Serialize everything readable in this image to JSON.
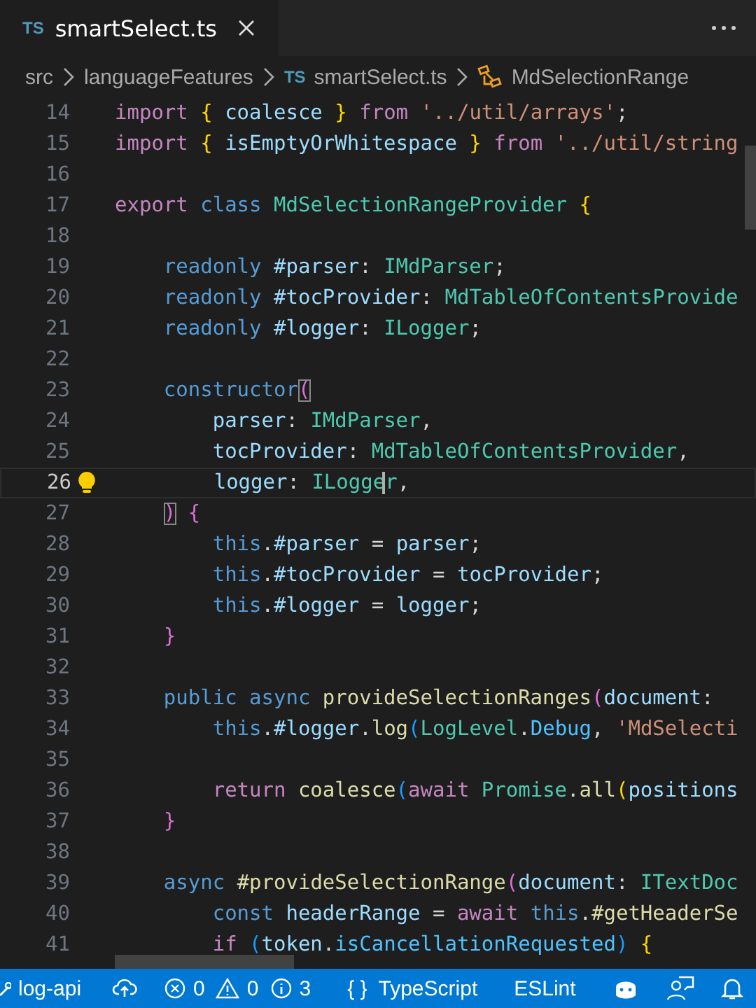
{
  "tabs": [
    {
      "lang": "TS",
      "label": "smartSelect.ts",
      "selected": true
    }
  ],
  "breadcrumbs": [
    {
      "kind": "folder",
      "label": "src"
    },
    {
      "kind": "folder",
      "label": "languageFeatures"
    },
    {
      "kind": "file",
      "lang": "TS",
      "label": "smartSelect.ts"
    },
    {
      "kind": "class",
      "label": "MdSelectionRange"
    }
  ],
  "code_lines": [
    {
      "number": "14",
      "tokens": [
        {
          "kind": "keyword",
          "text": "import "
        },
        {
          "kind": "bracket1",
          "text": "{"
        },
        {
          "kind": "variable",
          "text": " coalesce "
        },
        {
          "kind": "bracket1",
          "text": "}"
        },
        {
          "kind": "keyword",
          "text": " from "
        },
        {
          "kind": "string",
          "text": "'../util/arrays'"
        },
        {
          "kind": "plain",
          "text": ";"
        }
      ]
    },
    {
      "number": "15",
      "tokens": [
        {
          "kind": "keyword",
          "text": "import "
        },
        {
          "kind": "bracket1",
          "text": "{"
        },
        {
          "kind": "variable",
          "text": " isEmptyOrWhitespace "
        },
        {
          "kind": "bracket1",
          "text": "}"
        },
        {
          "kind": "keyword",
          "text": " from "
        },
        {
          "kind": "string",
          "text": "'../util/string"
        }
      ]
    },
    {
      "number": "16"
    },
    {
      "number": "17",
      "tokens": [
        {
          "kind": "keyword",
          "text": "export "
        },
        {
          "kind": "storage",
          "text": "class "
        },
        {
          "kind": "type",
          "text": "MdSelectionRangeProvider "
        },
        {
          "kind": "bracket1",
          "text": "{"
        }
      ]
    },
    {
      "number": "18"
    },
    {
      "number": "19",
      "tokens": [
        {
          "kind": "storage",
          "text": "    readonly "
        },
        {
          "kind": "variable",
          "text": "#parser"
        },
        {
          "kind": "plain",
          "text": ": "
        },
        {
          "kind": "type",
          "text": "IMdParser"
        },
        {
          "kind": "plain",
          "text": ";"
        }
      ]
    },
    {
      "number": "20",
      "tokens": [
        {
          "kind": "storage",
          "text": "    readonly "
        },
        {
          "kind": "variable",
          "text": "#tocProvider"
        },
        {
          "kind": "plain",
          "text": ": "
        },
        {
          "kind": "type",
          "text": "MdTableOfContentsProvide"
        }
      ]
    },
    {
      "number": "21",
      "tokens": [
        {
          "kind": "storage",
          "text": "    readonly "
        },
        {
          "kind": "variable",
          "text": "#logger"
        },
        {
          "kind": "plain",
          "text": ": "
        },
        {
          "kind": "type",
          "text": "ILogger"
        },
        {
          "kind": "plain",
          "text": ";"
        }
      ]
    },
    {
      "number": "22"
    },
    {
      "number": "23",
      "tokens": [
        {
          "kind": "storage",
          "text": "    constructor"
        },
        {
          "kind": "bracket2",
          "text": "(",
          "matched": true
        }
      ]
    },
    {
      "number": "24",
      "tokens": [
        {
          "kind": "variable",
          "text": "        parser"
        },
        {
          "kind": "plain",
          "text": ": "
        },
        {
          "kind": "type",
          "text": "IMdParser"
        },
        {
          "kind": "plain",
          "text": ","
        }
      ]
    },
    {
      "number": "25",
      "tokens": [
        {
          "kind": "variable",
          "text": "        tocProvider"
        },
        {
          "kind": "plain",
          "text": ": "
        },
        {
          "kind": "type",
          "text": "MdTableOfContentsProvider"
        },
        {
          "kind": "plain",
          "text": ","
        }
      ]
    },
    {
      "number": "26",
      "current": true,
      "lightbulb": true,
      "tokens": [
        {
          "kind": "variable",
          "text": "        logger"
        },
        {
          "kind": "plain",
          "text": ": "
        },
        {
          "kind": "type",
          "text": "ILogge"
        },
        {
          "kind": "type",
          "text": "r",
          "cursor": true
        },
        {
          "kind": "plain",
          "text": ","
        }
      ]
    },
    {
      "number": "27",
      "tokens": [
        {
          "kind": "bracket2",
          "text": "    )",
          "matched": true
        },
        {
          "kind": "bracket2",
          "text": " {"
        }
      ]
    },
    {
      "number": "28",
      "tokens": [
        {
          "kind": "storage",
          "text": "        this"
        },
        {
          "kind": "plain",
          "text": "."
        },
        {
          "kind": "variable",
          "text": "#parser"
        },
        {
          "kind": "plain",
          "text": " = "
        },
        {
          "kind": "variable",
          "text": "parser"
        },
        {
          "kind": "plain",
          "text": ";"
        }
      ]
    },
    {
      "number": "29",
      "tokens": [
        {
          "kind": "storage",
          "text": "        this"
        },
        {
          "kind": "plain",
          "text": "."
        },
        {
          "kind": "variable",
          "text": "#tocProvider"
        },
        {
          "kind": "plain",
          "text": " = "
        },
        {
          "kind": "variable",
          "text": "tocProvider"
        },
        {
          "kind": "plain",
          "text": ";"
        }
      ]
    },
    {
      "number": "30",
      "tokens": [
        {
          "kind": "storage",
          "text": "        this"
        },
        {
          "kind": "plain",
          "text": "."
        },
        {
          "kind": "variable",
          "text": "#logger"
        },
        {
          "kind": "plain",
          "text": " = "
        },
        {
          "kind": "variable",
          "text": "logger"
        },
        {
          "kind": "plain",
          "text": ";"
        }
      ]
    },
    {
      "number": "31",
      "tokens": [
        {
          "kind": "bracket2",
          "text": "    }"
        }
      ]
    },
    {
      "number": "32"
    },
    {
      "number": "33",
      "tokens": [
        {
          "kind": "storage",
          "text": "    public async "
        },
        {
          "kind": "function",
          "text": "provideSelectionRanges"
        },
        {
          "kind": "bracket2",
          "text": "("
        },
        {
          "kind": "variable",
          "text": "document"
        },
        {
          "kind": "plain",
          "text": ":"
        }
      ]
    },
    {
      "number": "34",
      "tokens": [
        {
          "kind": "storage",
          "text": "        this"
        },
        {
          "kind": "plain",
          "text": "."
        },
        {
          "kind": "variable",
          "text": "#logger"
        },
        {
          "kind": "plain",
          "text": "."
        },
        {
          "kind": "function",
          "text": "log"
        },
        {
          "kind": "bracket3",
          "text": "("
        },
        {
          "kind": "type",
          "text": "LogLevel"
        },
        {
          "kind": "plain",
          "text": "."
        },
        {
          "kind": "constant",
          "text": "Debug"
        },
        {
          "kind": "plain",
          "text": ", "
        },
        {
          "kind": "string",
          "text": "'MdSelecti"
        }
      ]
    },
    {
      "number": "35"
    },
    {
      "number": "36",
      "tokens": [
        {
          "kind": "keyword",
          "text": "        return "
        },
        {
          "kind": "function",
          "text": "coalesce"
        },
        {
          "kind": "bracket3",
          "text": "("
        },
        {
          "kind": "keyword",
          "text": "await "
        },
        {
          "kind": "type",
          "text": "Promise"
        },
        {
          "kind": "plain",
          "text": "."
        },
        {
          "kind": "function",
          "text": "all"
        },
        {
          "kind": "bracket1",
          "text": "("
        },
        {
          "kind": "variable",
          "text": "positions"
        }
      ]
    },
    {
      "number": "37",
      "tokens": [
        {
          "kind": "bracket2",
          "text": "    }"
        }
      ]
    },
    {
      "number": "38"
    },
    {
      "number": "39",
      "tokens": [
        {
          "kind": "storage",
          "text": "    async "
        },
        {
          "kind": "function",
          "text": "#provideSelectionRange"
        },
        {
          "kind": "bracket2",
          "text": "("
        },
        {
          "kind": "variable",
          "text": "document"
        },
        {
          "kind": "plain",
          "text": ": "
        },
        {
          "kind": "type",
          "text": "ITextDoc"
        }
      ]
    },
    {
      "number": "40",
      "tokens": [
        {
          "kind": "storage",
          "text": "        const "
        },
        {
          "kind": "variable",
          "text": "headerRange"
        },
        {
          "kind": "plain",
          "text": " = "
        },
        {
          "kind": "keyword",
          "text": "await "
        },
        {
          "kind": "storage",
          "text": "this"
        },
        {
          "kind": "plain",
          "text": "."
        },
        {
          "kind": "function",
          "text": "#getHeaderSe"
        }
      ]
    },
    {
      "number": "41",
      "tokens": [
        {
          "kind": "keyword",
          "text": "        if "
        },
        {
          "kind": "bracket3",
          "text": "("
        },
        {
          "kind": "variable",
          "text": "token"
        },
        {
          "kind": "plain",
          "text": "."
        },
        {
          "kind": "constant",
          "text": "isCancellationRequested"
        },
        {
          "kind": "bracket3",
          "text": ")"
        },
        {
          "kind": "bracket1",
          "text": " {"
        }
      ]
    }
  ],
  "status_bar": {
    "branch": "log-api",
    "errors": "0",
    "warnings": "0",
    "infos": "3",
    "language_icon": "{ }",
    "language": "TypeScript",
    "linter": "ESLint"
  }
}
